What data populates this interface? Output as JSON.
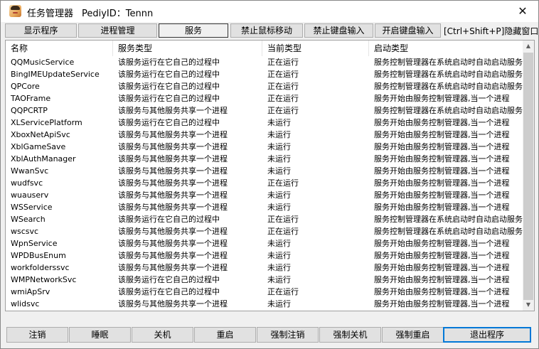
{
  "window": {
    "title": "任务管理器",
    "subtitle": "PediyID：Tennn",
    "close_label": "✕"
  },
  "tabs": [
    {
      "label": "显示程序"
    },
    {
      "label": "进程管理"
    },
    {
      "label": "服务"
    },
    {
      "label": "禁止鼠标移动"
    },
    {
      "label": "禁止键盘输入"
    },
    {
      "label": "开启键盘输入"
    }
  ],
  "active_tab": "服务",
  "hotkey_label": "[Ctrl+Shift+P]隐藏窗口",
  "table": {
    "columns": [
      "名称",
      "服务类型",
      "当前类型",
      "启动类型"
    ],
    "rows": [
      [
        "QQMusicService",
        "该服务运行在它自己的过程中",
        "正在运行",
        "服务控制管理器在系统启动时自动启动服务"
      ],
      [
        "BingIMEUpdateService",
        "该服务运行在它自己的过程中",
        "正在运行",
        "服务控制管理器在系统启动时自动启动服务"
      ],
      [
        "QPCore",
        "该服务运行在它自己的过程中",
        "正在运行",
        "服务控制管理器在系统启动时自动启动服务"
      ],
      [
        "TAOFrame",
        "该服务运行在它自己的过程中",
        "正在运行",
        "服务开始由服务控制管理器,当一个进程"
      ],
      [
        "QQPCRTP",
        "该服务与其他服务共享一个进程",
        "正在运行",
        "服务控制管理器在系统启动时自动启动服务"
      ],
      [
        "XLServicePlatform",
        "该服务运行在它自己的过程中",
        "未运行",
        "服务开始由服务控制管理器,当一个进程"
      ],
      [
        "XboxNetApiSvc",
        "该服务与其他服务共享一个进程",
        "未运行",
        "服务开始由服务控制管理器,当一个进程"
      ],
      [
        "XblGameSave",
        "该服务与其他服务共享一个进程",
        "未运行",
        "服务开始由服务控制管理器,当一个进程"
      ],
      [
        "XblAuthManager",
        "该服务与其他服务共享一个进程",
        "未运行",
        "服务开始由服务控制管理器,当一个进程"
      ],
      [
        "WwanSvc",
        "该服务与其他服务共享一个进程",
        "未运行",
        "服务开始由服务控制管理器,当一个进程"
      ],
      [
        "wudfsvc",
        "该服务与其他服务共享一个进程",
        "正在运行",
        "服务开始由服务控制管理器,当一个进程"
      ],
      [
        "wuauserv",
        "该服务与其他服务共享一个进程",
        "未运行",
        "服务开始由服务控制管理器,当一个进程"
      ],
      [
        "WSService",
        "该服务与其他服务共享一个进程",
        "未运行",
        "服务开始由服务控制管理器,当一个进程"
      ],
      [
        "WSearch",
        "该服务运行在它自己的过程中",
        "正在运行",
        "服务控制管理器在系统启动时自动启动服务"
      ],
      [
        "wscsvc",
        "该服务与其他服务共享一个进程",
        "正在运行",
        "服务控制管理器在系统启动时自动启动服务"
      ],
      [
        "WpnService",
        "该服务与其他服务共享一个进程",
        "未运行",
        "服务开始由服务控制管理器,当一个进程"
      ],
      [
        "WPDBusEnum",
        "该服务与其他服务共享一个进程",
        "未运行",
        "服务开始由服务控制管理器,当一个进程"
      ],
      [
        "workfolderssvc",
        "该服务与其他服务共享一个进程",
        "未运行",
        "服务开始由服务控制管理器,当一个进程"
      ],
      [
        "WMPNetworkSvc",
        "该服务运行在它自己的过程中",
        "未运行",
        "服务开始由服务控制管理器,当一个进程"
      ],
      [
        "wmiApSrv",
        "该服务运行在它自己的过程中",
        "正在运行",
        "服务开始由服务控制管理器,当一个进程"
      ],
      [
        "wlidsvc",
        "该服务与其他服务共享一个进程",
        "未运行",
        "服务开始由服务控制管理器,当一个进程"
      ]
    ]
  },
  "scrollbar": {
    "up": "▲",
    "down": "▼"
  },
  "bottom_buttons": [
    {
      "label": "注销"
    },
    {
      "label": "睡眠"
    },
    {
      "label": "关机"
    },
    {
      "label": "重启"
    },
    {
      "label": "强制注销"
    },
    {
      "label": "强制关机"
    },
    {
      "label": "强制重启"
    },
    {
      "label": "退出程序"
    }
  ]
}
